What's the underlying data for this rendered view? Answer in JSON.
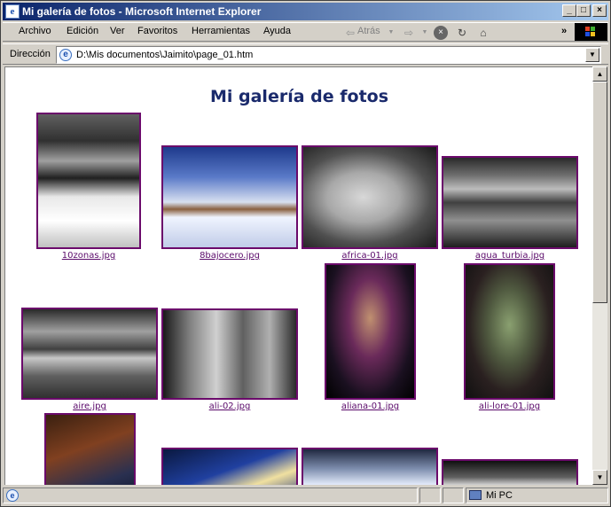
{
  "window": {
    "title": "Mi galería de fotos - Microsoft Internet Explorer",
    "minimize_icon": "minimize-icon",
    "maximize_icon": "maximize-icon",
    "close_icon": "close-icon"
  },
  "menu": {
    "items": [
      "Archivo",
      "Edición",
      "Ver",
      "Favoritos",
      "Herramientas",
      "Ayuda"
    ],
    "back_label": "Atrás",
    "more_label": "»"
  },
  "address": {
    "label": "Dirección",
    "value": "D:\\Mis documentos\\Jaimito\\page_01.htm"
  },
  "page": {
    "title": "Mi galería de fotos",
    "photos": [
      {
        "caption": "10zonas.jpg"
      },
      {
        "caption": "8bajocero.jpg"
      },
      {
        "caption": "africa-01.jpg"
      },
      {
        "caption": "agua_turbia.jpg"
      },
      {
        "caption": "aire.jpg"
      },
      {
        "caption": "ali-02.jpg"
      },
      {
        "caption": "aliana-01.jpg"
      },
      {
        "caption": "ali-lore-01.jpg"
      }
    ]
  },
  "status": {
    "zone": "Mi PC"
  }
}
